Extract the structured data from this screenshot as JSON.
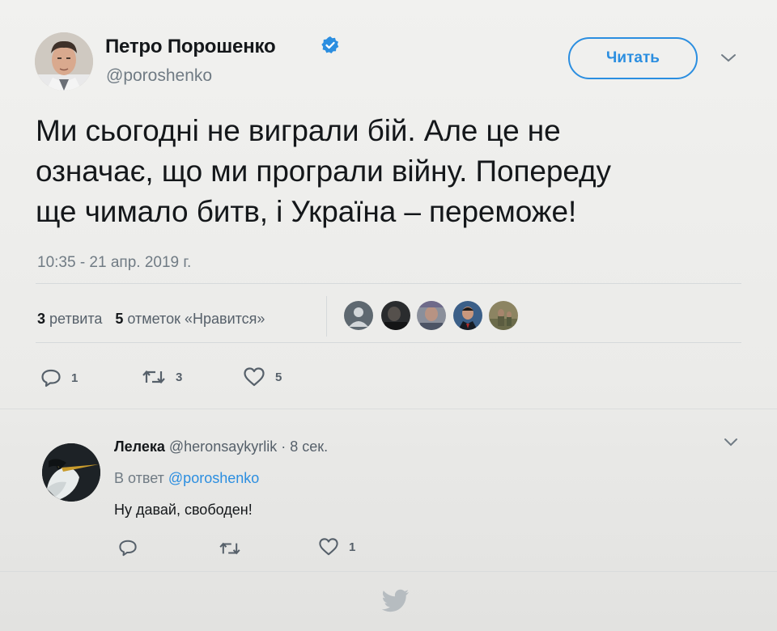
{
  "tweet": {
    "author_name": "Петро Порошенко",
    "author_handle": "@poroshenko",
    "follow_label": "Читать",
    "text_lines": [
      "Ми сьогодні не виграли бій. Але це не",
      "означає, що ми програли війну. Попереду",
      "ще чимало битв, і Україна – переможе!"
    ],
    "timestamp": "10:35 - 21 апр. 2019 г.",
    "stats": {
      "retweets_count": "3",
      "retweets_label": "ретвита",
      "likes_count": "5",
      "likes_label": "отметок «Нравится»"
    },
    "actions": {
      "reply_count": "1",
      "retweet_count": "3",
      "like_count": "5"
    }
  },
  "reply": {
    "name": "Лелека",
    "handle": "@heronsaykyrlik",
    "time": "· 8 сек.",
    "in_reply_prefix": "В ответ",
    "in_reply_handle": "@poroshenko",
    "text": "Ну давай, свободен!",
    "actions": {
      "reply_count": "",
      "retweet_count": "",
      "like_count": "1"
    }
  },
  "colors": {
    "accent": "#2b8ee0",
    "muted": "#707b84",
    "text": "#14171a"
  },
  "icons": [
    "verified-badge-icon",
    "chevron-down-icon",
    "reply-icon",
    "retweet-icon",
    "heart-icon",
    "twitter-bird-icon"
  ]
}
